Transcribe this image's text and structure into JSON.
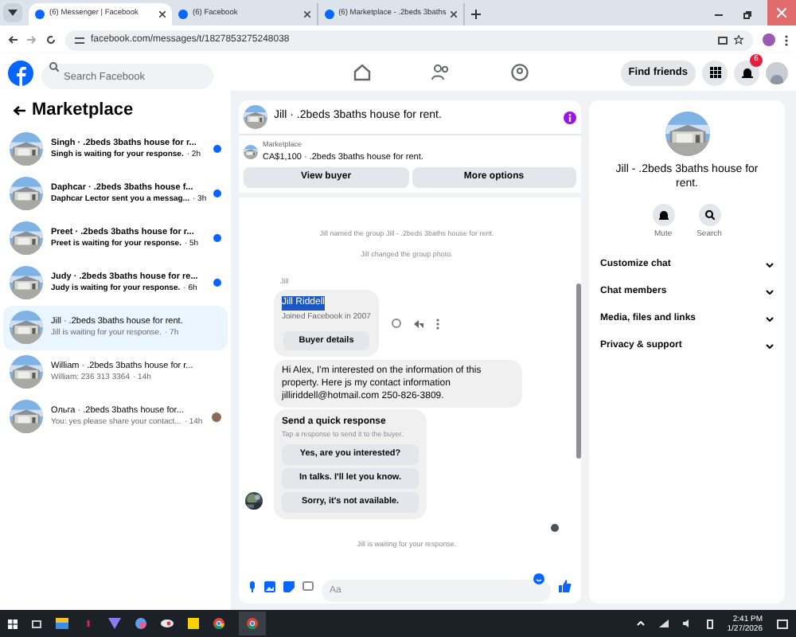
{
  "browser": {
    "tabs": [
      {
        "label": "(6) Messenger | Facebook",
        "selected": true
      },
      {
        "label": "(6) Facebook",
        "selected": false
      },
      {
        "label": "(6) Marketplace - .2beds 3baths",
        "selected": false
      }
    ],
    "url": "facebook.com/messages/t/1827853275248038"
  },
  "header": {
    "search": {
      "placeholder": "Search Facebook"
    },
    "find_friends": "Find friends",
    "notification_count": "6"
  },
  "sidebar": {
    "title": "Marketplace",
    "conversations": [
      {
        "title": "Singh · .2beds 3baths house for r...",
        "preview": "Singh is waiting for your response.",
        "time": "· 2h",
        "unread": true,
        "selected": false,
        "seen": false
      },
      {
        "title": "Daphcar · .2beds 3baths house f...",
        "preview": "Daphcar Lector sent you a messag...",
        "time": "· 3h",
        "unread": true,
        "selected": false,
        "seen": false
      },
      {
        "title": "Preet · .2beds 3baths house for r...",
        "preview": "Preet is waiting for your response.",
        "time": "· 5h",
        "unread": true,
        "selected": false,
        "seen": false
      },
      {
        "title": "Judy · .2beds 3baths house for re...",
        "preview": "Judy is waiting for your response.",
        "time": "· 6h",
        "unread": true,
        "selected": false,
        "seen": false
      },
      {
        "title": "Jill · .2beds 3baths house for rent.",
        "preview": "Jill is waiting for your response.",
        "time": "· 7h",
        "unread": false,
        "selected": true,
        "seen": false
      },
      {
        "title": "William · .2beds 3baths house for r...",
        "preview": "William: 236 313 3364",
        "time": "· 14h",
        "unread": false,
        "selected": false,
        "seen": false
      },
      {
        "title": "Ольга · .2beds 3baths house for...",
        "preview": "You: yes please share your contact...",
        "time": "· 14h",
        "unread": false,
        "selected": false,
        "seen": true
      }
    ]
  },
  "chat": {
    "title": "Jill · .2beds 3baths house for rent.",
    "listing": {
      "label": "Marketplace",
      "text": "CA$1,100 · .2beds 3baths house for rent."
    },
    "buttons": [
      "View buyer",
      "More options"
    ],
    "events": [
      "Jill named the group Jill - .2beds 3baths house for rent.",
      "Jill changed the group photo."
    ],
    "sender": "Jill",
    "profile": {
      "name": "Jill Riddell",
      "name_selected": true,
      "joined": "Joined Facebook in 2007",
      "button": "Buyer details"
    },
    "message": "Hi Alex, I'm interested on the information of this property. Here js my contact information jilliriddell@hotmail.com 250-826-3809.",
    "quick_response": {
      "title": "Send a quick response",
      "subtitle": "Tap a response to send it to the buyer.",
      "options": [
        "Yes, are you interested?",
        "In talks. I'll let you know.",
        "Sorry, it's not available."
      ]
    },
    "status": "Jill is waiting for your response.",
    "composer": {
      "placeholder": "Aa"
    }
  },
  "details": {
    "title": "Jill - .2beds 3baths house for rent.",
    "actions": [
      {
        "kind": "mute",
        "label": "Mute"
      },
      {
        "kind": "search",
        "label": "Search"
      }
    ],
    "sections": [
      "Customize chat",
      "Chat members",
      "Media, files and links",
      "Privacy & support"
    ]
  },
  "taskbar": {
    "time": "2:41 PM",
    "date": "1/27/2026"
  }
}
